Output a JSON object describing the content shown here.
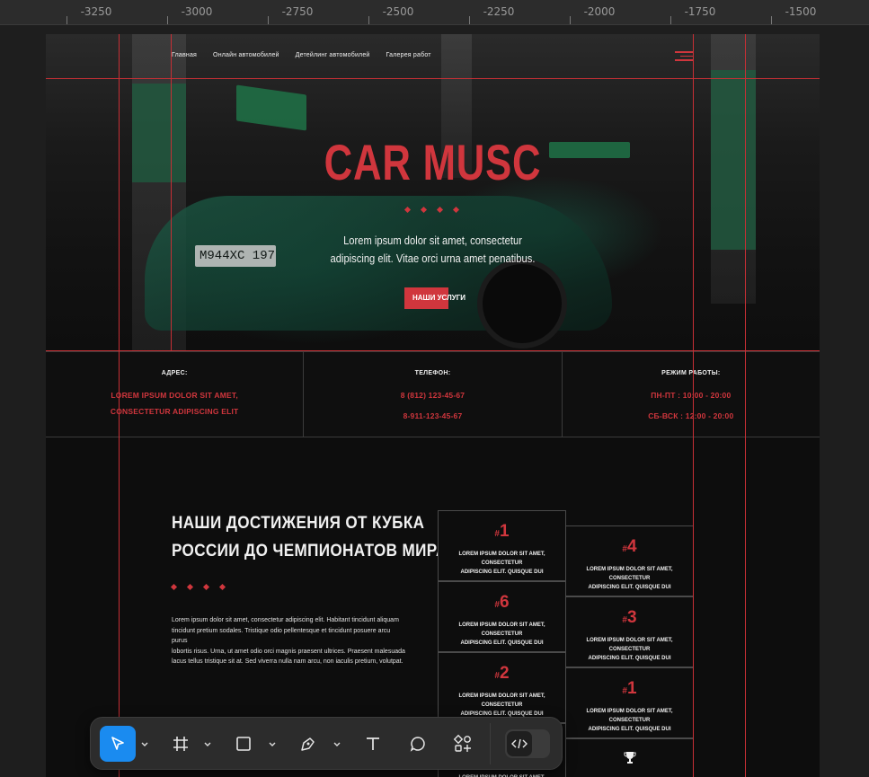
{
  "ruler": {
    "labels": [
      "-3250",
      "-3000",
      "-2750",
      "-2500",
      "-2250",
      "-2000",
      "-1750",
      "-1500"
    ]
  },
  "nav": {
    "items": [
      "Главная",
      "Онлайн автомобилей",
      "Детейлинг автомобилей",
      "Галерея работ"
    ]
  },
  "hero": {
    "plate": "М944ХС 197",
    "title": "CAR MUSC",
    "subtitle_line1": "Lorem ipsum dolor sit amet, consectetur",
    "subtitle_line2": "adipiscing elit. Vitae orci urna amet penatibus.",
    "button": "НАШИ УСЛУГИ"
  },
  "info": {
    "address_label": "АДРЕС:",
    "address_line1": "LOREM IPSUM DOLOR SIT AMET,",
    "address_line2": "CONSECTETUR ADIPISCING ELIT",
    "phone_label": "ТЕЛЕФОН:",
    "phone1": "8 (812) 123-45-67",
    "phone2": "8-911-123-45-67",
    "hours_label": "РЕЖИМ РАБОТЫ:",
    "hours1": "ПН-ПТ : 10:00 - 20:00",
    "hours2": "СБ-ВСК : 12:00 - 20:00"
  },
  "achievements": {
    "title_line1": "НАШИ ДОСТИЖЕНИЯ ОТ КУБКА",
    "title_line2": "РОССИИ ДО ЧЕМПИОНАТОВ МИРА",
    "text_line1": "Lorem ipsum dolor sit amet, consectetur adipiscing elit. Habitant tincidunt aliquam",
    "text_line2": "tincidunt pretium sodales. Tristique odio pellentesque et tincidunt posuere arcu purus",
    "text_line3": "lobortis risus. Urna, ut amet odio orci magnis praesent ultrices. Praesent malesuada",
    "text_line4": "lacus tellus tristique sit at. Sed viverra nulla nam arcu, non iaculis pretium, volutpat.",
    "card_hash": "#",
    "card_text_line1": "LOREM IPSUM DOLOR SIT AMET, CONSECTETUR",
    "card_text_line2": "ADIPISCING ELIT. QUISQUE DUI",
    "cards_left": [
      "1",
      "6",
      "2"
    ],
    "cards_right": [
      "4",
      "3",
      "1"
    ]
  },
  "colors": {
    "accent": "#d0363d",
    "toolbar_active": "#1a8bf0"
  },
  "toolbar": {
    "tools": [
      "move-icon",
      "frame-icon",
      "rectangle-icon",
      "pen-icon",
      "text-icon",
      "comment-icon",
      "components-icon",
      "dev-mode-icon"
    ]
  }
}
